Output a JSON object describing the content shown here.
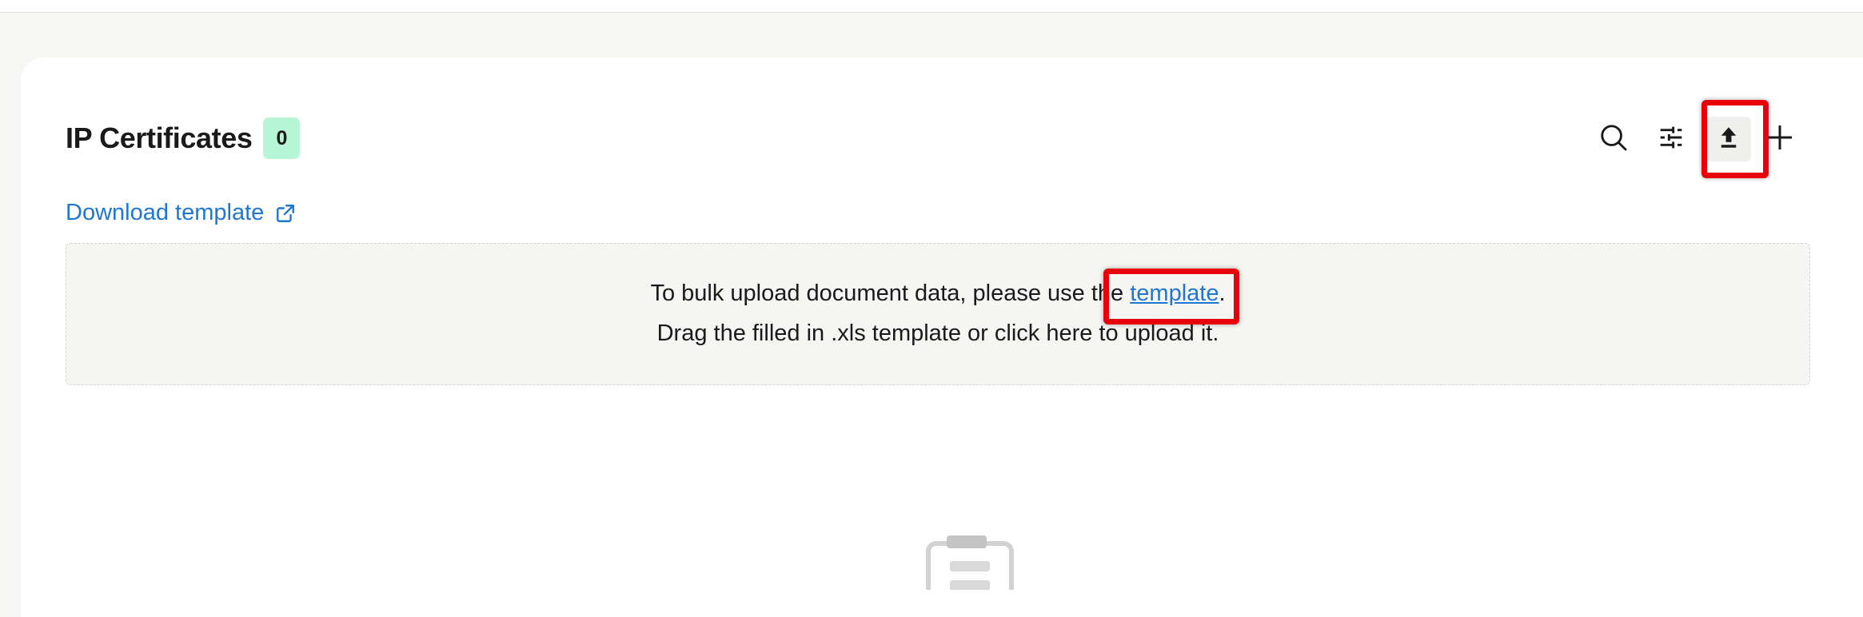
{
  "section": {
    "title": "IP Certificates",
    "count": "0"
  },
  "download": {
    "label": "Download template",
    "icon": "external-link-icon"
  },
  "toolbar": {
    "search_icon": "search-icon",
    "filter_icon": "sliders-icon",
    "upload_icon": "upload-icon",
    "add_icon": "plus-icon"
  },
  "dropzone": {
    "line1_prefix": "To bulk upload document data, please use the ",
    "line1_link": "template",
    "line1_suffix": ".",
    "line2": "Drag the filled in .xls template or click here to upload it."
  },
  "empty_state": {
    "icon": "clipboard-icon"
  },
  "colors": {
    "accent": "#1f77d0",
    "badge": "#b6f5d6",
    "highlight": "#e8000b",
    "background": "#f6f6f4"
  }
}
